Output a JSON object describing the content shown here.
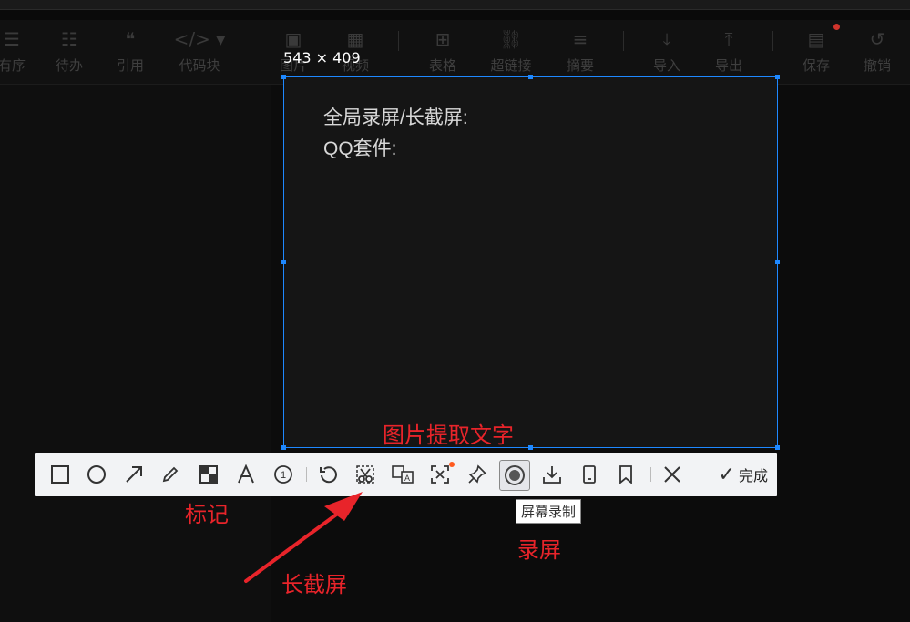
{
  "editor_toolbar": {
    "items": [
      {
        "label": "有序",
        "icon": "ordered-list-icon"
      },
      {
        "label": "待办",
        "icon": "todo-list-icon"
      },
      {
        "label": "引用",
        "icon": "quote-icon"
      },
      {
        "label": "代码块",
        "icon": "code-block-icon"
      },
      {
        "label": "图片",
        "icon": "image-icon"
      },
      {
        "label": "视频",
        "icon": "video-icon"
      },
      {
        "label": "表格",
        "icon": "table-icon"
      },
      {
        "label": "超链接",
        "icon": "link-icon"
      },
      {
        "label": "摘要",
        "icon": "summary-icon"
      },
      {
        "label": "导入",
        "icon": "import-icon"
      },
      {
        "label": "导出",
        "icon": "export-icon"
      },
      {
        "label": "保存",
        "icon": "save-icon"
      },
      {
        "label": "撤销",
        "icon": "undo-icon"
      }
    ]
  },
  "capture": {
    "dimensions": "543 × 409",
    "lines": [
      "全局录屏/长截屏:",
      "QQ套件:"
    ]
  },
  "snip_toolbar": {
    "tools": [
      {
        "name": "rectangle",
        "icon": "rectangle-icon"
      },
      {
        "name": "ellipse",
        "icon": "ellipse-icon"
      },
      {
        "name": "arrow",
        "icon": "arrow-icon"
      },
      {
        "name": "pen",
        "icon": "pen-icon"
      },
      {
        "name": "mosaic",
        "icon": "mosaic-icon"
      },
      {
        "name": "text",
        "icon": "text-icon"
      },
      {
        "name": "number",
        "icon": "number-icon"
      },
      {
        "name": "undo",
        "icon": "undo-icon"
      },
      {
        "name": "long-screenshot",
        "icon": "scissors-icon"
      },
      {
        "name": "translate",
        "icon": "translate-icon"
      },
      {
        "name": "ocr",
        "icon": "ocr-icon"
      },
      {
        "name": "pin",
        "icon": "pin-icon"
      },
      {
        "name": "record",
        "icon": "record-icon"
      },
      {
        "name": "download",
        "icon": "download-icon"
      },
      {
        "name": "phone",
        "icon": "phone-icon"
      },
      {
        "name": "bookmark",
        "icon": "bookmark-icon"
      },
      {
        "name": "close",
        "icon": "close-icon"
      }
    ],
    "done_label": "完成",
    "tooltip": "屏幕录制"
  },
  "annotations": {
    "ocr_label": "图片提取文字",
    "mark_label": "标记",
    "long_shot_label": "长截屏",
    "record_label": "录屏"
  },
  "colors": {
    "selection": "#1e88ff",
    "annotation": "#e8242a"
  }
}
